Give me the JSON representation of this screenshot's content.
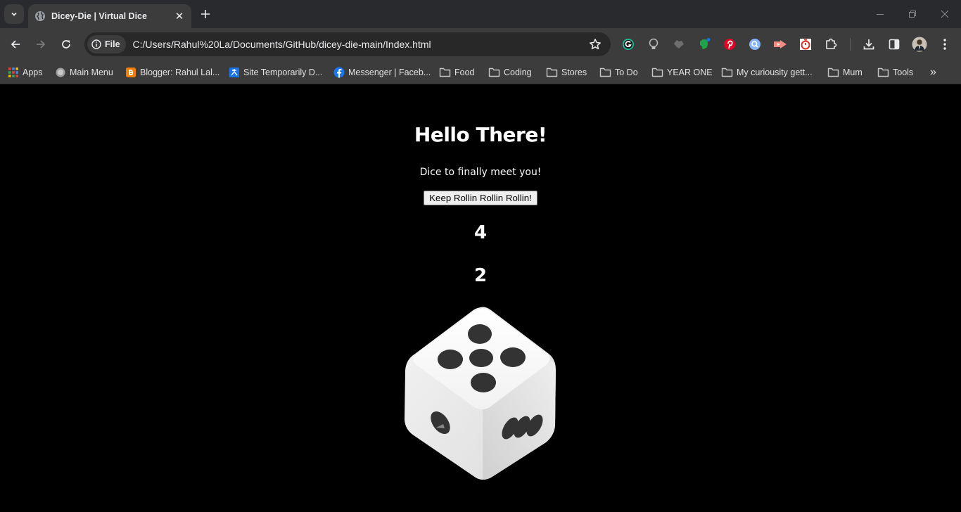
{
  "browser": {
    "tab": {
      "title": "Dicey-Die | Virtual Dice"
    },
    "address_bar": {
      "chip_label": "File",
      "url": "C:/Users/Rahul%20La/Documents/GitHub/dicey-die-main/Index.html"
    },
    "extensions": [
      "grammarly-icon",
      "lightbulb-icon",
      "wolf-icon",
      "evernote-icon",
      "pinterest-icon",
      "search-extension-icon",
      "screencast-icon",
      "timer-icon",
      "puzzle-icon"
    ],
    "bookmarks": [
      {
        "label": "Apps",
        "icon": "apps-grid-icon"
      },
      {
        "label": "Main Menu",
        "icon": "circle-icon"
      },
      {
        "label": "Blogger: Rahul Lal...",
        "icon": "blogger-icon"
      },
      {
        "label": "Site Temporarily D...",
        "icon": "site-icon"
      },
      {
        "label": "Messenger | Faceb...",
        "icon": "facebook-icon"
      },
      {
        "label": "Food",
        "icon": "folder-icon"
      },
      {
        "label": "Coding",
        "icon": "folder-icon"
      },
      {
        "label": "Stores",
        "icon": "folder-icon"
      },
      {
        "label": "To Do",
        "icon": "folder-icon"
      },
      {
        "label": "YEAR ONE",
        "icon": "folder-icon"
      },
      {
        "label": "My curiousity gett...",
        "icon": "folder-icon"
      },
      {
        "label": "Mum",
        "icon": "folder-icon"
      },
      {
        "label": "Tools",
        "icon": "folder-icon"
      }
    ],
    "bookmarks_overflow": "»"
  },
  "page": {
    "heading": "Hello There!",
    "subtitle": "Dice to finally meet you!",
    "roll_button": "Keep Rollin Rollin Rollin!",
    "result_first": "4",
    "result_second": "2",
    "dice_image": {
      "top_face_pips": 5,
      "left_face_pips": 1,
      "right_face_pips": 3
    }
  }
}
